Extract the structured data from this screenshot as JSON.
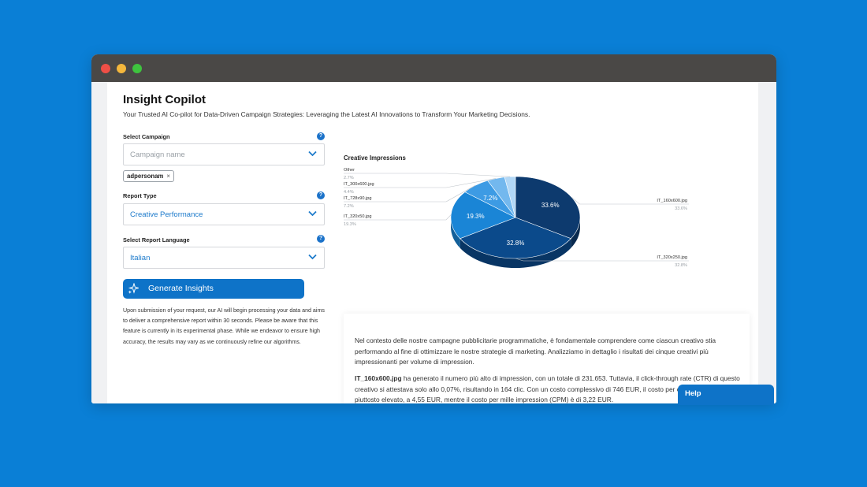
{
  "app": {
    "title": "Insight Copilot",
    "subtitle": "Your Trusted AI Co-pilot for Data-Driven Campaign Strategies: Leveraging the Latest AI Innovations to Transform Your Marketing Decisions."
  },
  "form": {
    "campaign": {
      "label": "Select Campaign",
      "placeholder": "Campaign name",
      "tags": [
        "adpersonam"
      ]
    },
    "report_type": {
      "label": "Report Type",
      "value": "Creative Performance"
    },
    "language": {
      "label": "Select Report Language",
      "value": "Italian"
    },
    "help_icon": "?",
    "remove_icon": "×",
    "generate_label": "Generate Insights",
    "note": "Upon submission of your request, our AI will begin processing your data and aims to deliver a comprehensive report within 30 seconds. Please be aware that this feature is currently in its experimental phase. While we endeavor to ensure high accuracy, the results may vary as we continuously refine our algorithms."
  },
  "chart_data": {
    "type": "pie",
    "title": "Creative Impressions",
    "slices": [
      {
        "label": "IT_160x600.jpg",
        "value": 33.6,
        "legend_pct": "33.6%",
        "inner_label": "33.6%",
        "color": "#0d3a6e"
      },
      {
        "label": "IT_320x250.jpg",
        "value": 32.8,
        "legend_pct": "32.8%",
        "inner_label": "32.8%",
        "color": "#0b4a8b"
      },
      {
        "label": "IT_320x50.jpg",
        "value": 19.3,
        "legend_pct": "19.3%",
        "inner_label": "19.3%",
        "color": "#1a85d6"
      },
      {
        "label": "IT_728x90.jpg",
        "value": 7.2,
        "legend_pct": "7.2%",
        "inner_label": "7.2%",
        "color": "#3d9be4"
      },
      {
        "label": "IT_300x600.jpg",
        "value": 4.4,
        "legend_pct": "4.4%",
        "inner_label": "",
        "color": "#73b8ee"
      },
      {
        "label": "Other",
        "value": 2.7,
        "legend_pct": "2.7%",
        "inner_label": "",
        "color": "#b1d7f6"
      }
    ]
  },
  "report": {
    "intro": "Nel contesto delle nostre campagne pubblicitarie programmatiche, è fondamentale comprendere come ciascun creativo stia performando al fine di ottimizzare le nostre strategie di marketing. Analizziamo in dettaglio i risultati dei cinque creativi più impressionanti per volume di impression.",
    "item_name": "IT_160x600.jpg",
    "item_text": " ha generato il numero più alto di impression, con un totale di 231.653. Tuttavia, il click-through rate (CTR) di questo creativo si attestava solo allo 0,07%, risultando in 164 clic. Con un costo complessivo di 746 EUR, il costo per clic (CPC) è risultato piuttosto elevato, a 4,55 EUR, mentre il costo per mille impression (CPM) è di 3,22 EUR."
  },
  "help_button": "Help",
  "colors": {
    "accent": "#0e73c8",
    "background": "#0a7fd6",
    "titlebar": "#4a4846"
  }
}
